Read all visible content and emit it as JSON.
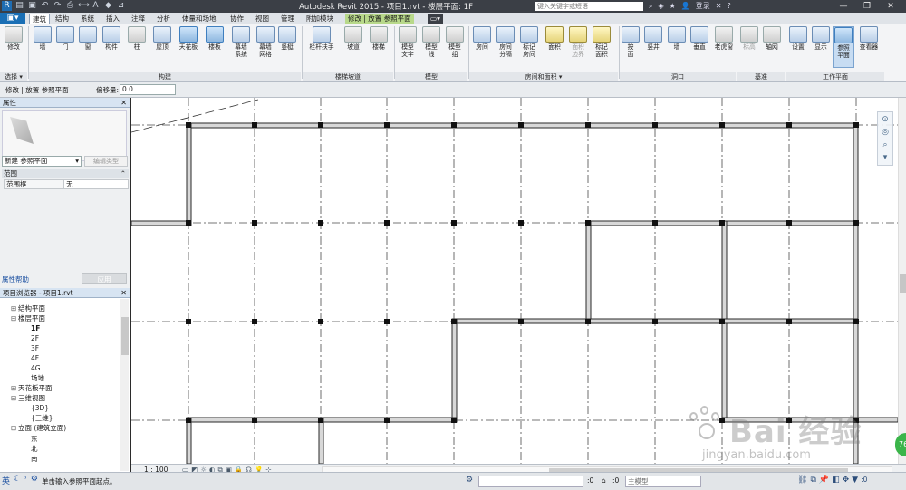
{
  "titlebar": {
    "app_title": "Autodesk Revit 2015 -    项目1.rvt - 楼层平面: 1F",
    "search_placeholder": "键入关键字或短语",
    "sign_in": "登录",
    "help": "?"
  },
  "tabs": [
    {
      "label": "建筑",
      "state": "active"
    },
    {
      "label": "结构"
    },
    {
      "label": "系统"
    },
    {
      "label": "插入"
    },
    {
      "label": "注释"
    },
    {
      "label": "分析"
    },
    {
      "label": "体量和场地"
    },
    {
      "label": "协作"
    },
    {
      "label": "视图"
    },
    {
      "label": "管理"
    },
    {
      "label": "附加模块"
    },
    {
      "label": "修改 | 放置 参照平面",
      "state": "context"
    }
  ],
  "ribbon": {
    "buttons": {
      "modify": "修改",
      "wall": "墙",
      "door": "门",
      "window": "窗",
      "component": "构件",
      "column": "柱",
      "roof": "屋顶",
      "ceiling": "天花板",
      "floor": "楼板",
      "curtain_system_1": "幕墙",
      "curtain_system_2": "系统",
      "curtain_grid_1": "幕墙",
      "curtain_grid_2": "网格",
      "mullion": "竖梃",
      "railing": "栏杆扶手",
      "ramp": "坡道",
      "stair": "楼梯",
      "model_text_1": "模型",
      "model_text_2": "文字",
      "model_line_1": "模型",
      "model_line_2": "线",
      "model_group_1": "模型",
      "model_group_2": "组",
      "room": "房间",
      "room_sep_1": "房间",
      "room_sep_2": "分隔",
      "tag_room_1": "标记",
      "tag_room_2": "房间",
      "area": "面积",
      "area_boundary_1": "面积",
      "area_boundary_2": "边界",
      "tag_area_1": "标记",
      "tag_area_2": "面积",
      "by_face_1": "按",
      "by_face_2": "面",
      "shaft": "竖井",
      "opening_wall": "墙",
      "vertical": "垂直",
      "dormer": "老虎窗",
      "level": "标高",
      "grid": "轴网",
      "set": "设置",
      "show": "显示",
      "ref_plane_1": "参照",
      "ref_plane_2": "平面",
      "viewer": "查看器"
    },
    "panels": {
      "select": "选择 ▾",
      "build": "构建",
      "circulation": "楼梯坡道",
      "model": "模型",
      "room_area": "房间和面积 ▾",
      "opening": "洞口",
      "datum": "基准",
      "work_plane": "工作平面"
    }
  },
  "optionsbar": {
    "context": "修改 | 放置 参照平面",
    "offset_label": "偏移量:",
    "offset_value": "0.0"
  },
  "properties": {
    "title": "属性",
    "type_selector": "新建 参照平面",
    "edit_type": "编辑类型",
    "category": "范围",
    "row_key": "范围框",
    "row_value": "无",
    "help": "属性帮助",
    "apply": "应用"
  },
  "browser": {
    "title": "项目浏览器 - 项目1.rvt",
    "nodes": [
      {
        "label": "结构平面",
        "level": 1,
        "toggle": "⊞"
      },
      {
        "label": "楼层平面",
        "level": 1,
        "toggle": "⊟"
      },
      {
        "label": "1F",
        "level": 2,
        "bold": true
      },
      {
        "label": "2F",
        "level": 2
      },
      {
        "label": "3F",
        "level": 2
      },
      {
        "label": "4F",
        "level": 2
      },
      {
        "label": "4G",
        "level": 2
      },
      {
        "label": "场地",
        "level": 2
      },
      {
        "label": "天花板平面",
        "level": 1,
        "toggle": "⊞"
      },
      {
        "label": "三维视图",
        "level": 1,
        "toggle": "⊟"
      },
      {
        "label": "{3D}",
        "level": 2
      },
      {
        "label": "{三维}",
        "level": 2
      },
      {
        "label": "立面 (建筑立面)",
        "level": 1,
        "toggle": "⊟"
      },
      {
        "label": "东",
        "level": 2
      },
      {
        "label": "北",
        "level": 2
      },
      {
        "label": "南",
        "level": 2
      }
    ]
  },
  "viewbar": {
    "scale": "1 : 100"
  },
  "status": {
    "message": "单击输入参照平面起点。",
    "zero_1": ":0",
    "zero_2": ":0",
    "model_field": "主模型"
  },
  "watermark": {
    "brand": "Bai 经验",
    "url": "jingyan.baidu.com"
  },
  "badge": "76"
}
